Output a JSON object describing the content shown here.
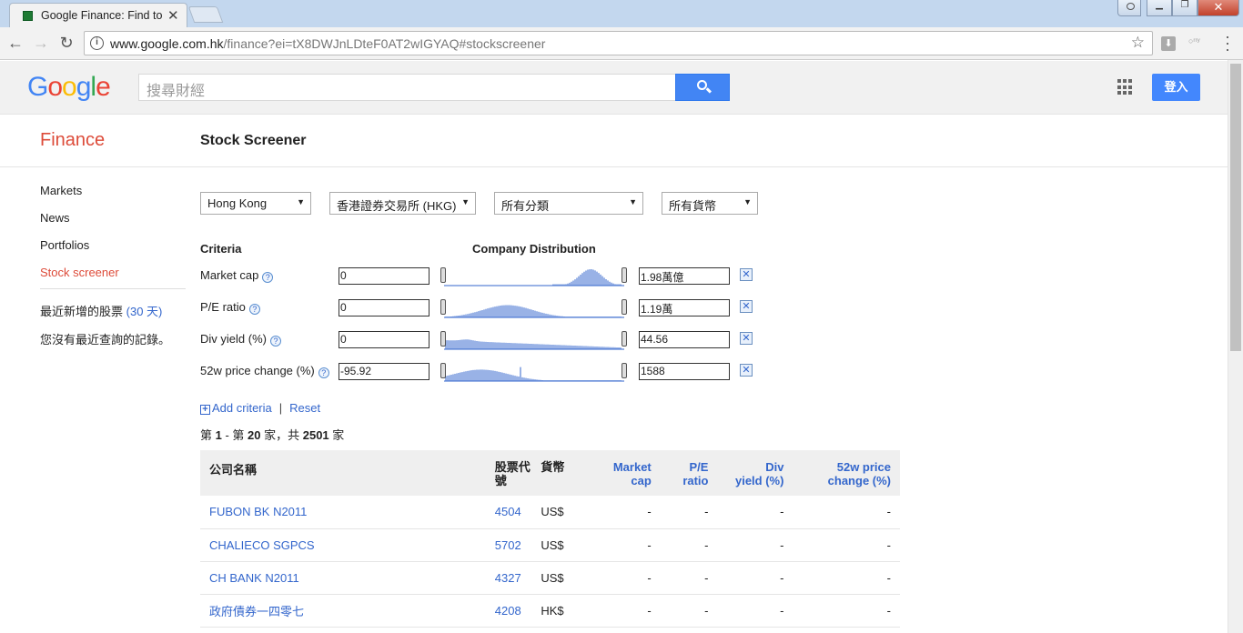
{
  "browser": {
    "tab_title": "Google Finance: Find to",
    "url_host": "www.google.com.hk",
    "url_rest": "/finance?ei=tX8DWJnLDteF0AT2wIGYAQ#stockscreener"
  },
  "header": {
    "logo_letters": [
      {
        "ch": "G",
        "color": "#4285f4"
      },
      {
        "ch": "o",
        "color": "#ea4335"
      },
      {
        "ch": "o",
        "color": "#fbbc05"
      },
      {
        "ch": "g",
        "color": "#4285f4"
      },
      {
        "ch": "l",
        "color": "#34a853"
      },
      {
        "ch": "e",
        "color": "#ea4335"
      }
    ],
    "search_placeholder": "搜尋財經",
    "signin_label": "登入"
  },
  "finance": {
    "title": "Finance",
    "page_title": "Stock Screener"
  },
  "nav": {
    "items": [
      "Markets",
      "News",
      "Portfolios",
      "Stock screener"
    ],
    "active_index": 3,
    "recent_label": "最近新增的股票",
    "recent_days": "(30 天)",
    "no_recent": "您沒有最近查詢的記錄。"
  },
  "filters": {
    "region": "Hong Kong",
    "exchange": "香港證券交易所 (HKG)",
    "sector": "所有分類",
    "currency": "所有貨幣"
  },
  "criteria": {
    "header_label": "Criteria",
    "dist_label": "Company Distribution",
    "rows": [
      {
        "label": "Market cap",
        "min": "0",
        "max": "1.98萬億"
      },
      {
        "label": "P/E ratio",
        "min": "0",
        "max": "1.19萬"
      },
      {
        "label": "Div yield (%)",
        "min": "0",
        "max": "44.56"
      },
      {
        "label": "52w price change (%)",
        "min": "-95.92",
        "max": "1588"
      }
    ],
    "add_label": "Add criteria",
    "reset_label": "Reset"
  },
  "results": {
    "count_parts": [
      "第 ",
      "1",
      " - 第 ",
      "20",
      " 家，共 ",
      "2501",
      " 家"
    ],
    "columns": {
      "name": "公司名稱",
      "symbol": "股票代號",
      "currency": "貨幣",
      "market_cap": [
        "Market",
        "cap"
      ],
      "pe": [
        "P/E",
        "ratio"
      ],
      "div": [
        "Div",
        "yield (%)"
      ],
      "change": [
        "52w price",
        "change (%)"
      ]
    },
    "rows": [
      {
        "name": "FUBON BK N2011",
        "symbol": "4504",
        "currency": "US$",
        "market_cap": "-",
        "pe": "-",
        "div": "-",
        "change": "-"
      },
      {
        "name": "CHALIECO SGPCS",
        "symbol": "5702",
        "currency": "US$",
        "market_cap": "-",
        "pe": "-",
        "div": "-",
        "change": "-"
      },
      {
        "name": "CH BANK N2011",
        "symbol": "4327",
        "currency": "US$",
        "market_cap": "-",
        "pe": "-",
        "div": "-",
        "change": "-"
      },
      {
        "name": "政府債券一四零七",
        "symbol": "4208",
        "currency": "HK$",
        "market_cap": "-",
        "pe": "-",
        "div": "-",
        "change": "-"
      }
    ]
  },
  "colors": {
    "accent": "#3366cc",
    "finance_red": "#dd4b39",
    "search_blue": "#4285f4"
  }
}
